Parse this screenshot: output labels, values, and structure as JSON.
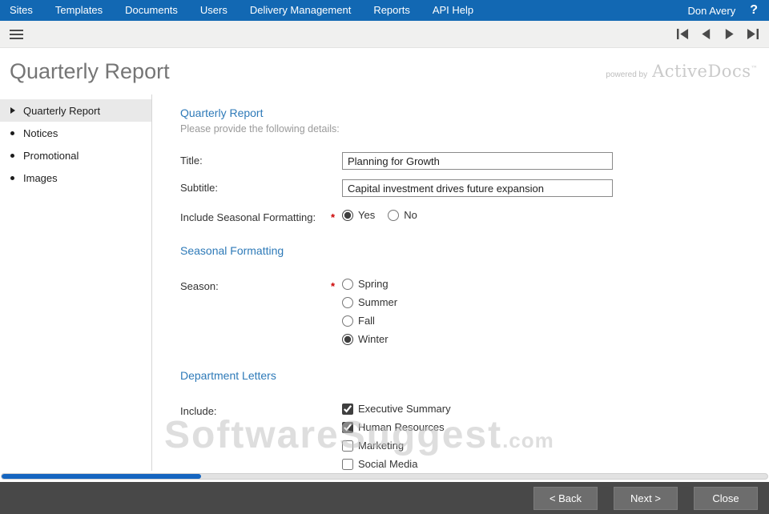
{
  "topnav": {
    "items": [
      "Sites",
      "Templates",
      "Documents",
      "Users",
      "Delivery Management",
      "Reports",
      "API Help"
    ],
    "user": "Don Avery",
    "help": "?"
  },
  "header": {
    "title": "Quarterly Report",
    "powered_by": "powered by",
    "brand": "ActiveDocs",
    "brand_tm": "™"
  },
  "sidebar": {
    "items": [
      {
        "label": "Quarterly Report",
        "selected": true
      },
      {
        "label": "Notices",
        "selected": false
      },
      {
        "label": "Promotional",
        "selected": false
      },
      {
        "label": "Images",
        "selected": false
      }
    ]
  },
  "form": {
    "section_title": "Quarterly Report",
    "section_subtitle": "Please provide the following details:",
    "title": {
      "label": "Title:",
      "value": "Planning for Growth"
    },
    "subtitle": {
      "label": "Subtitle:",
      "value": "Capital investment drives future expansion"
    },
    "seasonal_formatting": {
      "label": "Include Seasonal Formatting:",
      "required": "*",
      "options": [
        {
          "label": "Yes",
          "selected": true
        },
        {
          "label": "No",
          "selected": false
        }
      ]
    },
    "seasonal_section": "Seasonal Formatting",
    "season": {
      "label": "Season:",
      "required": "*",
      "options": [
        {
          "label": "Spring",
          "selected": false
        },
        {
          "label": "Summer",
          "selected": false
        },
        {
          "label": "Fall",
          "selected": false
        },
        {
          "label": "Winter",
          "selected": true
        }
      ]
    },
    "departments_section": "Department Letters",
    "include": {
      "label": "Include:",
      "options": [
        {
          "label": "Executive Summary",
          "checked": true
        },
        {
          "label": "Human Resources",
          "checked": true
        },
        {
          "label": "Marketing",
          "checked": false
        },
        {
          "label": "Social Media",
          "checked": false
        }
      ]
    }
  },
  "watermark": {
    "text": "SoftwareSuggest",
    "suffix": ".com"
  },
  "progress": {
    "percent": 26
  },
  "footer": {
    "back": "< Back",
    "next": "Next >",
    "close": "Close"
  },
  "colors": {
    "nav_blue": "#1268b3",
    "accent_blue": "#2e7ab8",
    "progress_blue": "#1565c0",
    "required_red": "#cc0000",
    "footer_gray": "#484848"
  }
}
